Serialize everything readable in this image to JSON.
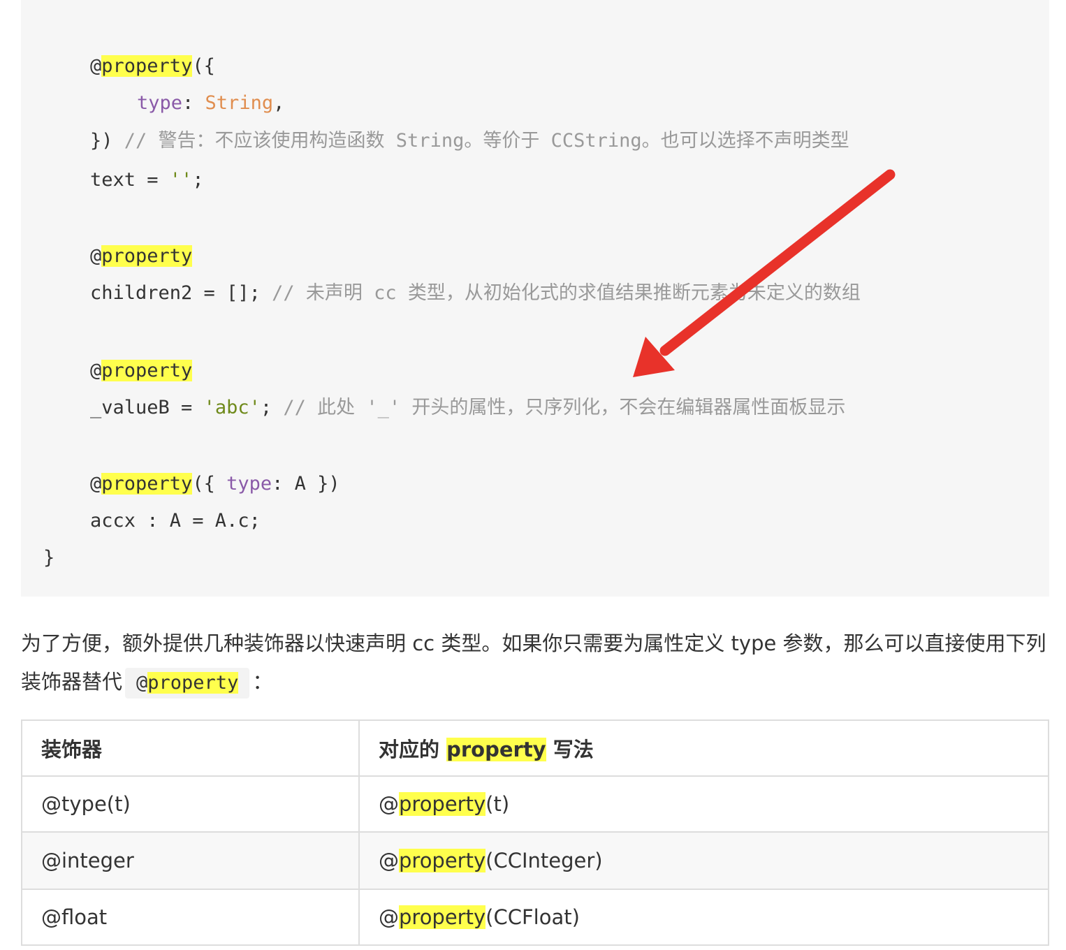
{
  "code": {
    "at": "@",
    "property": "property",
    "line1_tail": "({",
    "line2_attr": "type",
    "line2_colon": ": ",
    "line2_value": "String",
    "line2_comma": ",",
    "line3_head": "}) ",
    "line3_comment": "// 警告：不应该使用构造函数 String。等价于 CCString。也可以选择不声明类型",
    "line4_head": "text = ",
    "line4_str": "''",
    "line4_tail": ";",
    "line6_head": "children2 = []; ",
    "line6_comment": "// 未声明 cc 类型，从初始化式的求值结果推断元素为未定义的数组",
    "line8_head": "_valueB = ",
    "line8_str": "'abc'",
    "line8_mid": "; ",
    "line8_comment": "// 此处 '_' 开头的属性，只序列化，不会在编辑器属性面板显示",
    "line10_open": "({ ",
    "line10_attr": "type",
    "line10_tail": ": A })",
    "line11": "accx : A = A.c;",
    "line12": "}"
  },
  "paragraph": {
    "text_before": "为了方便，额外提供几种装饰器以快速声明 cc 类型。如果你只需要为属性定义 type 参数，那么可以直接使用下列装饰器替代",
    "inline_at": "@",
    "inline_property": "property",
    "text_after": "："
  },
  "table": {
    "header_col1": "装饰器",
    "header_col2_before": "对应的 ",
    "header_col2_hl": "property",
    "header_col2_after": " 写法",
    "rows": [
      {
        "decorator": "@type(t)",
        "at": "@",
        "hl": "property",
        "arg": "(t)"
      },
      {
        "decorator": "@integer",
        "at": "@",
        "hl": "property",
        "arg": "(CCInteger)"
      },
      {
        "decorator": "@float",
        "at": "@",
        "hl": "property",
        "arg": "(CCFloat)"
      }
    ]
  },
  "colors": {
    "highlight": "#ffff4d",
    "arrow": "#e8322a",
    "code_bg": "#f6f6f6",
    "attr": "#8a5aa8",
    "string_orange": "#e08d4e",
    "string_green": "#6f8a1b",
    "comment": "#999999"
  }
}
